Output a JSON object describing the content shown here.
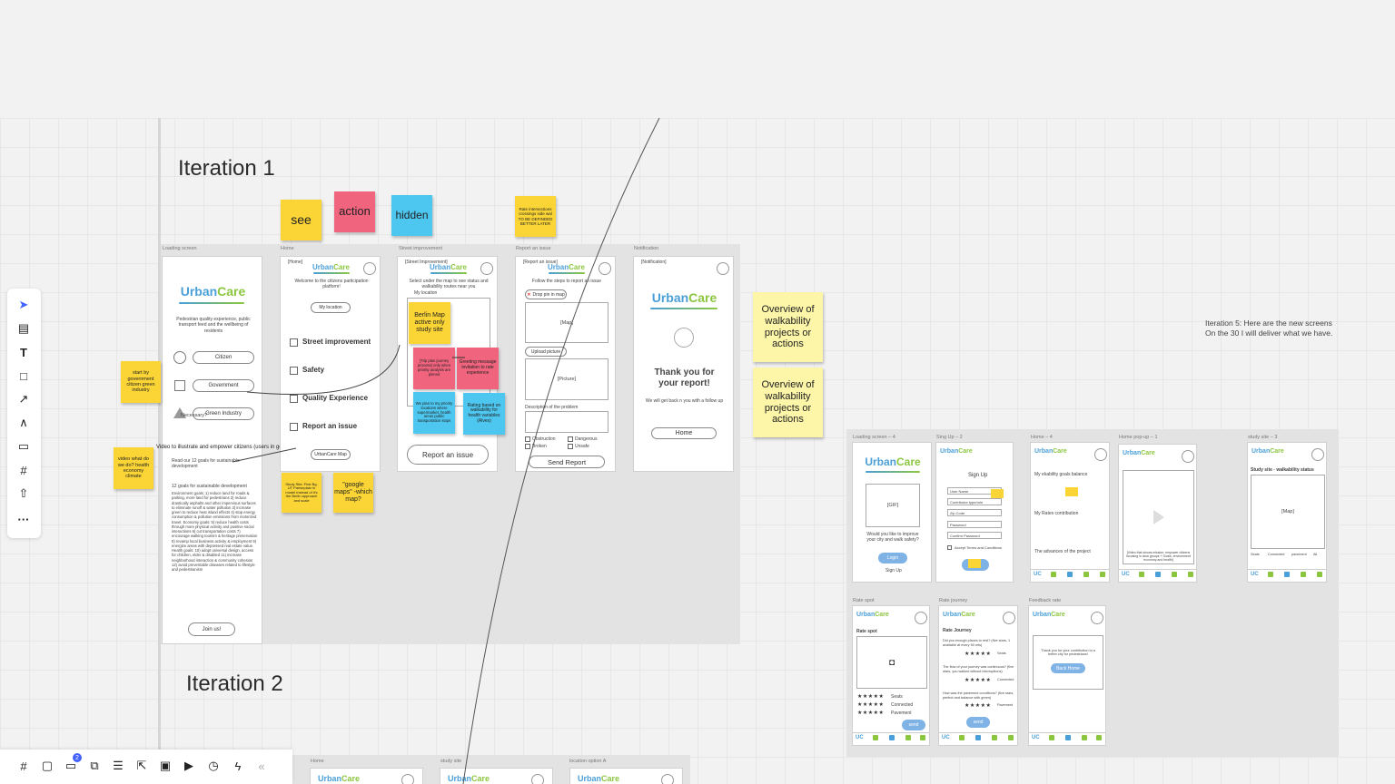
{
  "board": {
    "iteration1_title": "Iteration 1",
    "iteration2_title": "Iteration 2",
    "iteration5_note_line1": "Iteration 5: Here are the new screens",
    "iteration5_note_line2": "On the 30 I will deliver what we have."
  },
  "legend_stickies": {
    "see": "see",
    "action": "action",
    "hidden": "hidden",
    "small_yellow": "Rate intersections crossings side wal TO BE DEFINDED BETTER LATER"
  },
  "side_stickies": {
    "start_by": "start by government citizen green industry",
    "video_what": "video what do we do? health economy climate",
    "overview1": "Overview of walkability projects or actions",
    "overview2": "Overview of walkability projects or actions",
    "study_site_first": "Study Site: First Bg. UT Pariseplatz in model instead of it's the Berlin approach and scale",
    "google_maps": "\"google maps\" -which map?",
    "berlin_map": "Berlin Map active only study site",
    "pink1": "(Trip plan journey process) only when priority analysis are pinned",
    "pink2": "Greeting message invitation to rate experience",
    "blue1": "We plan to my priority locations where supermarket, health areas public transportation stops",
    "blue2": "Rating based on walkability for health variables (Alves)"
  },
  "frames": {
    "loading": {
      "label": "Loading screen",
      "tagline": "Pedestrian quality experience, public transport feed and the wellbeing of residents",
      "options": [
        "Citizen",
        "Government",
        "Green Industry"
      ],
      "necessary": "Necessary?",
      "video_caption": "Video to illustrate and empower citizens (users in general)",
      "read_goals": "Read our 12 goals for sustainable development",
      "goals_title": "12 goals for sustainable development",
      "goals_text": "Environment goals: 1) reduce land for roads & parking, more land for pedestrians 2) reduce drastically asphalts and other impervious surfaces to eliminate runoff & water pollution 3) increase green to reduce heat island effects 4) stop energy consumption & pollution emissions from motorized travel. Economy goals: 5) reduce health costs through more physical activity and positive social interactions 6) cut transportation costs 7) encourage walking tourism & heritage preservation 8) revamp local business activity & employment 9) energize areas with depressed real estate value. Health goals: 10) adopt universal design, access for children, elder & disabled 11) increase neighborhood interaction & community cohesion 12) avoid preventable diseases related to lifestyle and pedestrianism",
      "join": "Join us!"
    },
    "home": {
      "label": "Home",
      "tag": "[Home]",
      "welcome": "Welcome to the citizens participation platform!",
      "my_location": "My location",
      "items": [
        "Street improvement",
        "Safety",
        "Quality Experience",
        "Report an issue"
      ],
      "map_btn": "UrbanCare Map"
    },
    "street": {
      "label": "Street improvement",
      "tag": "[Street Improvement]",
      "intro": "Select under the map to see status and walkability routes near you",
      "my_location": "My location",
      "report_btn": "Report an issue"
    },
    "report": {
      "label": "Report an issue",
      "tag": "[Report an issue]",
      "follow": "Follow the steps to report an issue",
      "drop_pin": "Drop pin in map",
      "map": "[Map]",
      "upload": "Upload picture",
      "picture": "[Picture]",
      "description": "Description of the problem",
      "checks": [
        "Obstruction",
        "Dangerous",
        "Broken",
        "Unsafe"
      ],
      "send": "Send Report"
    },
    "notification": {
      "label": "Notification",
      "tag": "[Notification]",
      "thanks": "Thank you for your report!",
      "followup": "We will get back n you with a follow up",
      "home": "Home"
    }
  },
  "brand": {
    "urban": "Urban",
    "care": "Care",
    "uc": "UC"
  },
  "iteration5": {
    "labels": [
      "Loading screen – 4",
      "Sing Up – 2",
      "Home – 4",
      "Home pop-up – 1",
      "study site – 3",
      "Rate spot",
      "Rate journey",
      "Feedback rate"
    ],
    "loading": {
      "gif": "[GIF]",
      "question": "Would you like to improve your city and walk safety?",
      "login": "Login",
      "signup": "Sign Up"
    },
    "signup": {
      "title": "Sign Up",
      "fields": [
        "User Name",
        "Contributor type/role",
        "Zip Code",
        "Password",
        "Confirm Password"
      ],
      "terms": "Accept Terms and Conditions"
    },
    "home": {
      "goals": "My ekability goals balance",
      "rates": "My Rates contribution",
      "advances": "The advances of the project"
    },
    "popup": {
      "video": "[Video that shows mission: empower citizens focusing in slow groups + Goals, environment economy and health]"
    },
    "study": {
      "title": "Study site - walkability status",
      "map": "[Map]",
      "checks": [
        "Seats",
        "Connected",
        "pavement",
        "All"
      ]
    },
    "rate_spot": {
      "title": "Rate spot",
      "rows": [
        "Seats",
        "Connected",
        "Pavement"
      ],
      "send": "send"
    },
    "rate_journey": {
      "title": "Rate Journey",
      "q1": "Did you enough places to rest? (five stars, 1 available at every 50 mts)",
      "a1": "Seats",
      "q2": "The flow of your journey was continuous? (five stars, you walked without interruptions)",
      "a2": "Connected",
      "q3": "How was the pavement conditions? (five stars, perfect and balance with green)",
      "a3": "Pavement",
      "send": "send"
    },
    "feedback": {
      "thanks": "Thank you for your contribution to a better city for pedestrians!",
      "back": "Back Home"
    },
    "nav": [
      "Home",
      "Study site",
      "Location",
      "My journey",
      "Rate"
    ]
  },
  "iteration2_frames": [
    "Home",
    "study site",
    "location option A"
  ],
  "toolbar": [
    "select",
    "templates",
    "text",
    "shape",
    "pen-arrow",
    "pen",
    "comment",
    "frame",
    "upload",
    "more"
  ],
  "bottom_bar": {
    "badge": "2",
    "collapse": "«"
  }
}
